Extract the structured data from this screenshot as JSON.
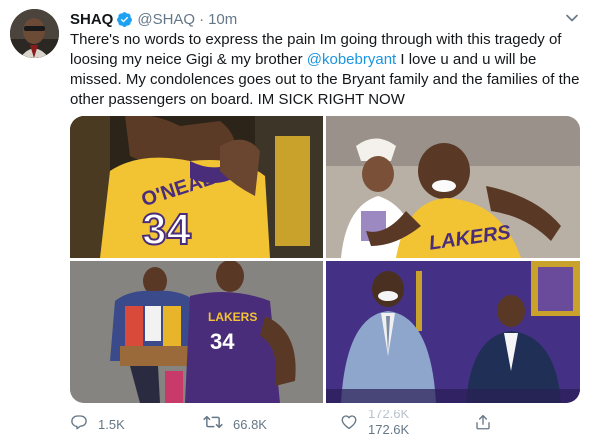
{
  "tweet": {
    "author_name": "SHAQ",
    "handle": "@SHAQ",
    "separator": "·",
    "time": "10m",
    "text_part1": "There's no words to express the pain Im going through with this tragedy of loosing my neice Gigi & my brother ",
    "mention": "@kobebryant",
    "text_part2": " I love u and u will be missed. My condolences goes out to the Bryant family and the families of the other passengers on board. IM SICK RIGHT NOW"
  },
  "photos": {
    "p1_jersey_name": "O'NEAL",
    "p1_jersey_number": "34",
    "p2_jersey_text": "LAKERS",
    "p3_jersey_text": "LAKERS",
    "p3_jersey_number": "34"
  },
  "actions": {
    "reply_count": "1.5K",
    "retweet_count": "66.8K",
    "like_count": "172.6K",
    "like_count_prev": "172.6K"
  },
  "colors": {
    "link": "#1b95e0",
    "secondary_text": "#657786",
    "verified": "#1da1f2"
  }
}
